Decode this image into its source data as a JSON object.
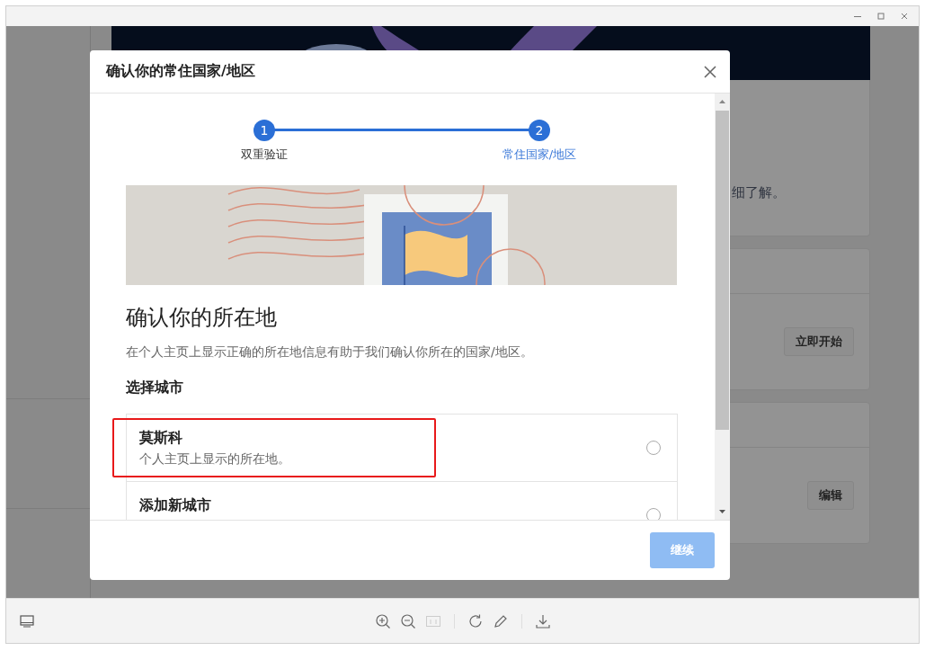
{
  "background_page": {
    "card_text": "细了解。",
    "buttons": [
      {
        "label": "立即开始"
      },
      {
        "label": "编辑"
      }
    ]
  },
  "dialog": {
    "title": "确认你的常住国家/地区",
    "steps": [
      {
        "number": "1",
        "label": "双重验证",
        "selected": false
      },
      {
        "number": "2",
        "label": "常住国家/地区",
        "selected": true
      }
    ],
    "heading": "确认你的所在地",
    "description": "在个人主页上显示正确的所在地信息有助于我们确认你所在的国家/地区。",
    "section_label": "选择城市",
    "options": [
      {
        "title": "莫斯科",
        "subtitle": "个人主页上显示的所在地。",
        "selected": false,
        "highlighted": true
      },
      {
        "title": "添加新城市",
        "selected": false,
        "highlighted": false
      }
    ],
    "continue_button": {
      "label": "继续",
      "disabled": true
    }
  }
}
